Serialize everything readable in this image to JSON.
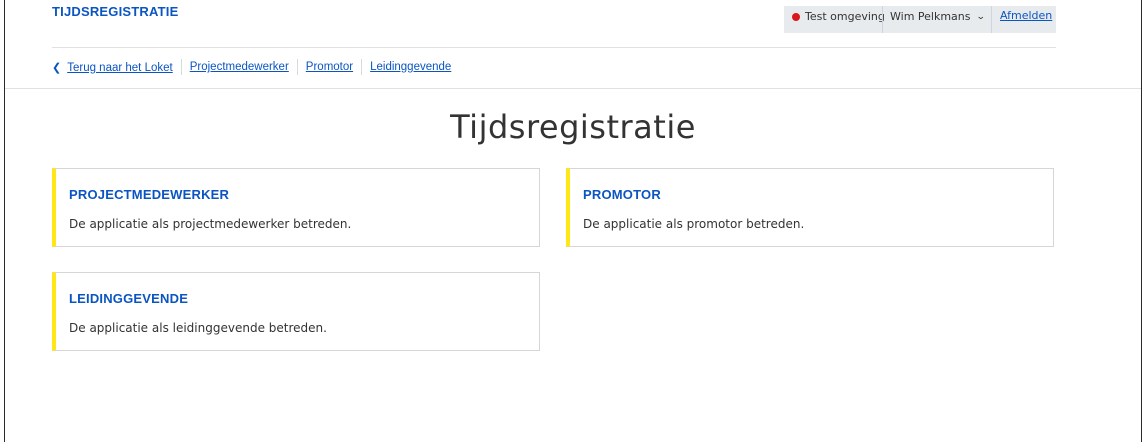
{
  "app": {
    "brand": "TIJDSREGISTRATIE"
  },
  "userbar": {
    "environment": "Test omgeving",
    "user_name": "Wim Pelkmans",
    "logout": "Afmelden"
  },
  "breadcrumbs": [
    {
      "label": "Terug naar het Loket"
    },
    {
      "label": "Projectmedewerker"
    },
    {
      "label": "Promotor"
    },
    {
      "label": "Leidinggevende"
    }
  ],
  "page": {
    "title": "Tijdsregistratie"
  },
  "cards": [
    {
      "title": "PROJECTMEDEWERKER",
      "description": "De applicatie als projectmedewerker betreden."
    },
    {
      "title": "PROMOTOR",
      "description": "De applicatie als promotor betreden."
    },
    {
      "title": "LEIDINGGEVENDE",
      "description": "De applicatie als leidinggevende betreden."
    }
  ],
  "colors": {
    "link": "#0b55c2",
    "accent_yellow": "#ffe615",
    "env_dot": "#d8181b",
    "userbar_bg": "#e8ebee"
  },
  "icons": {
    "back": "chevron-left-icon",
    "user_menu": "chevron-down-icon",
    "env": "status-dot-icon"
  }
}
